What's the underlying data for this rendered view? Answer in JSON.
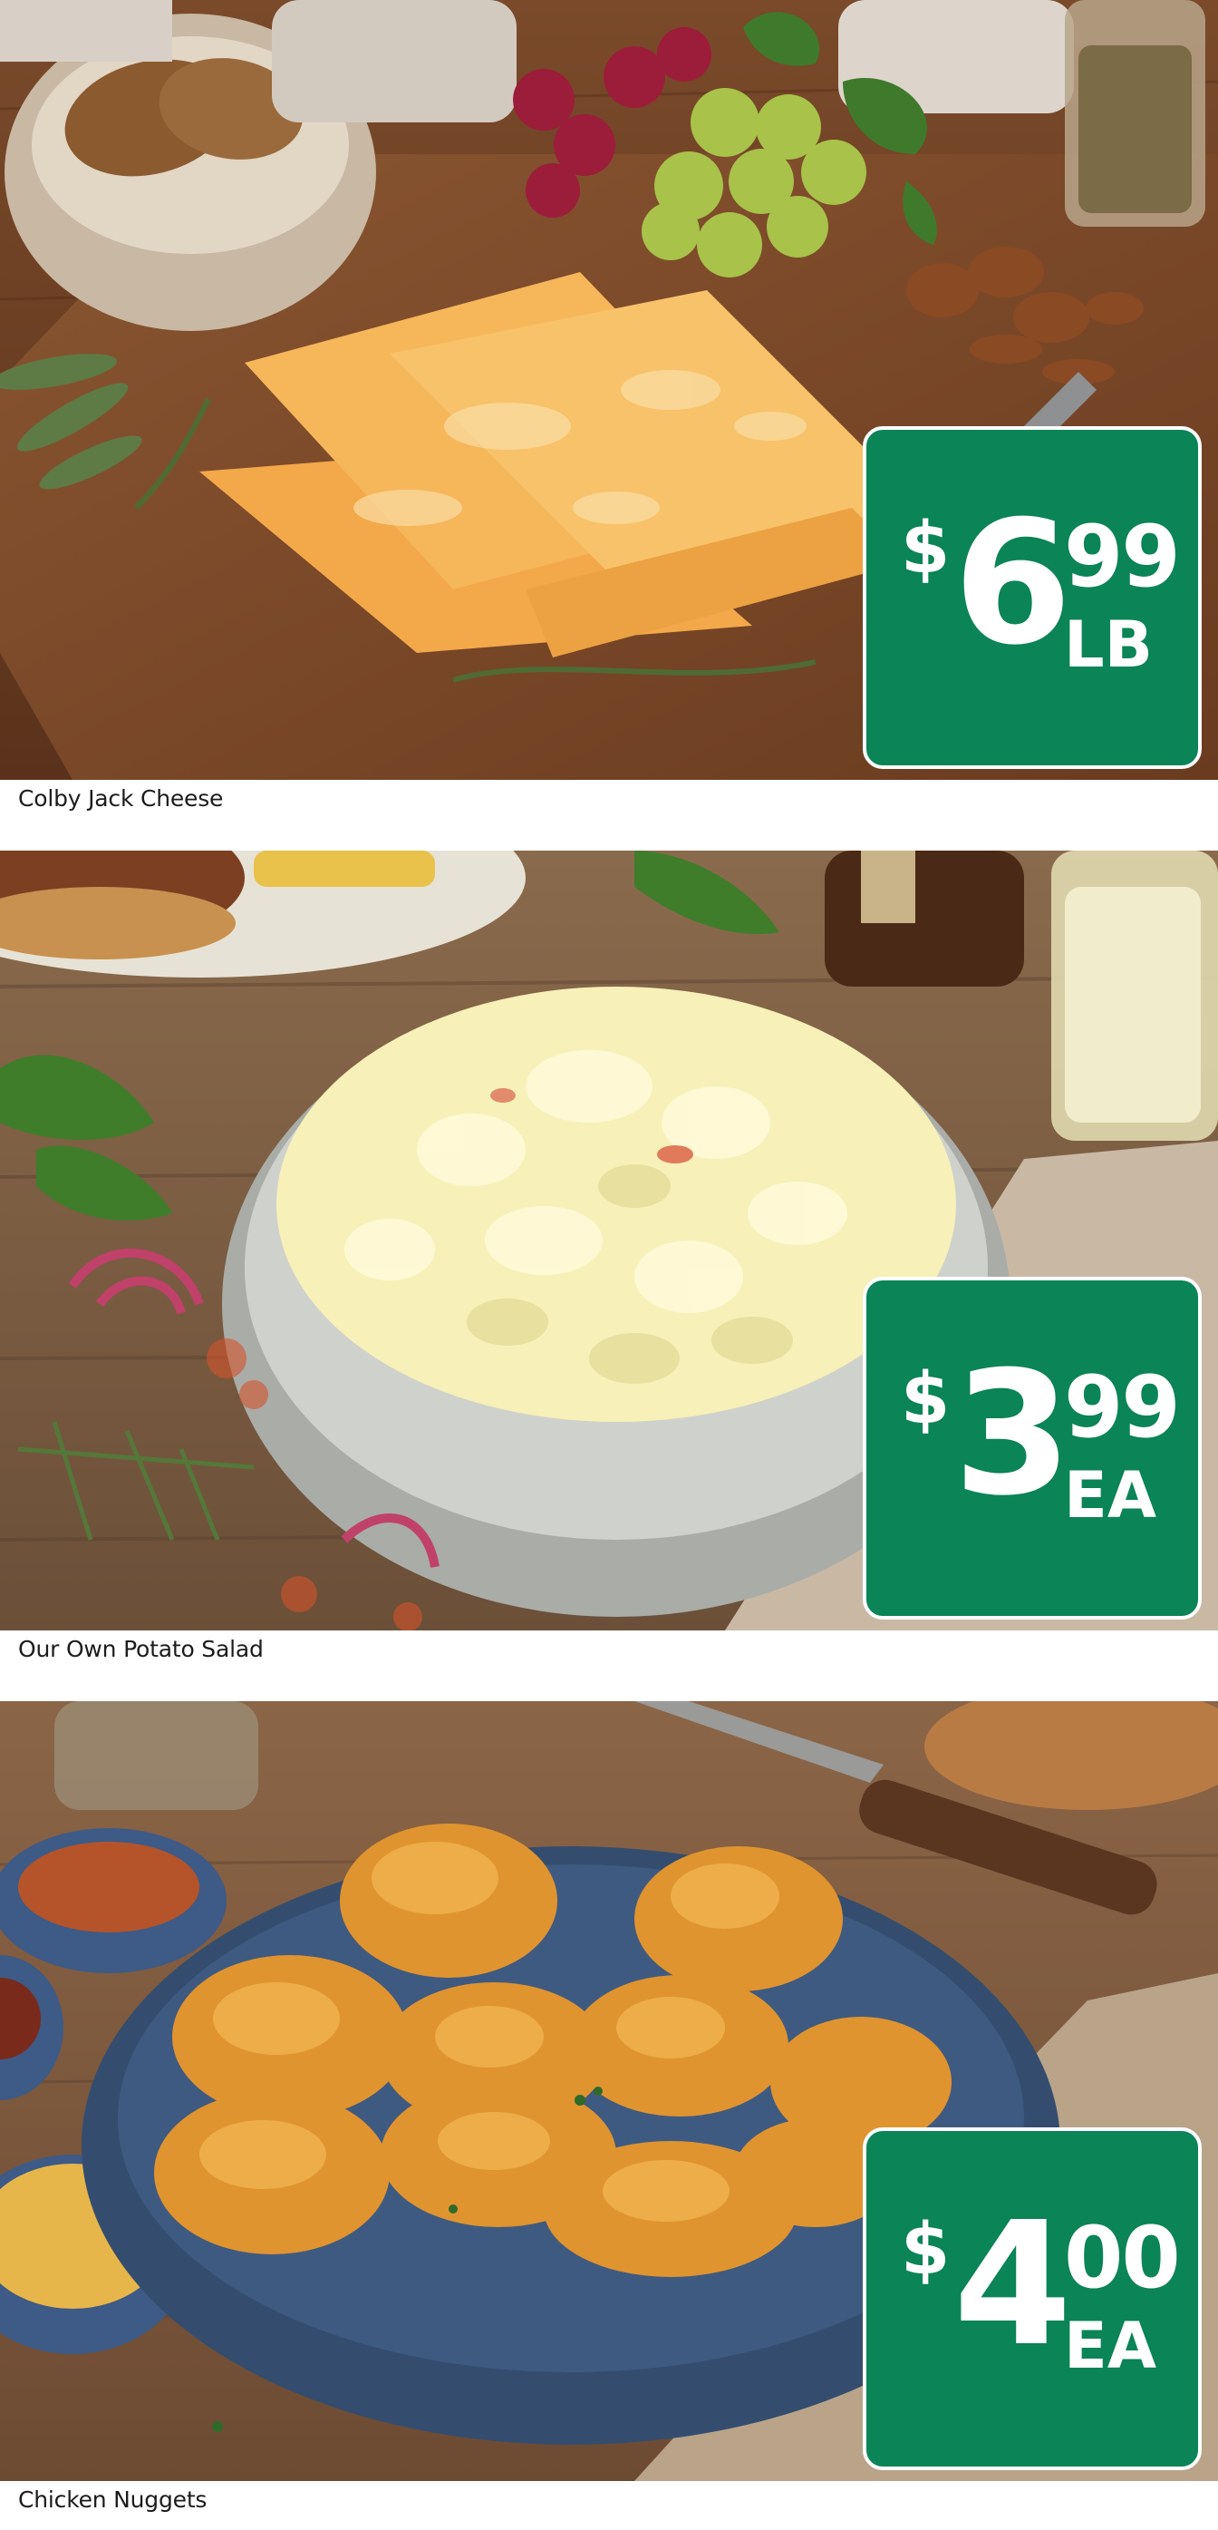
{
  "theme": {
    "tag_color": "#0b8457",
    "text_color": "#1c1c1c"
  },
  "items": [
    {
      "name": "Colby Jack Cheese",
      "currency": "$",
      "dollars": "6",
      "cents": "99",
      "unit": "LB",
      "image": "colby-jack-cheese-photo"
    },
    {
      "name": "Our Own Potato Salad",
      "currency": "$",
      "dollars": "3",
      "cents": "99",
      "unit": "EA",
      "image": "potato-salad-photo"
    },
    {
      "name": "Chicken Nuggets",
      "currency": "$",
      "dollars": "4",
      "cents": "00",
      "unit": "EA",
      "image": "chicken-nuggets-photo"
    }
  ]
}
